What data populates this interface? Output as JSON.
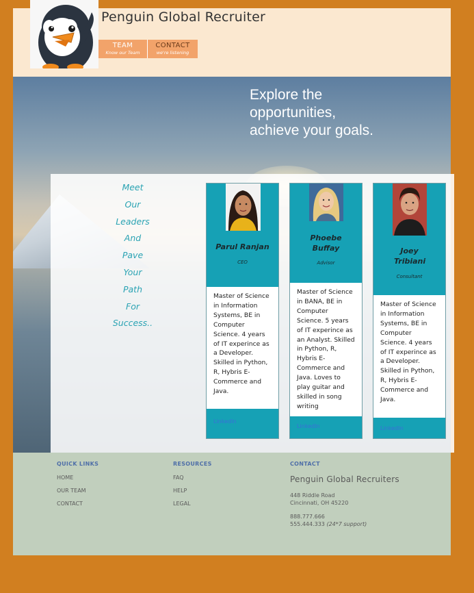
{
  "header": {
    "site_title": "Penguin Global Recruiter",
    "logo_icon": "penguin-mascot-icon",
    "nav": [
      {
        "title": "TEAM",
        "subtitle": "Know our Team"
      },
      {
        "title": "CONTACT",
        "subtitle": "we're listening"
      }
    ]
  },
  "hero": {
    "tagline": "Explore the\nopportunities,\nachieve your goals."
  },
  "leaders": {
    "heading_words": [
      "Meet",
      "Our",
      "Leaders",
      "And",
      "Pave",
      "Your",
      "Path",
      "For",
      "Success.."
    ]
  },
  "team": [
    {
      "name": "Parul Ranjan",
      "role": "CEO",
      "bio": "Master of Science in Information Systems, BE in Computer Science. 4 years of IT experince as a Developer. Skilled in Python, R, Hybris E-Commerce and Java.",
      "link": "LinkedIn"
    },
    {
      "name": "Phoebe Buffay",
      "role": "Advisor",
      "bio": "Master of Science in BANA, BE in Computer Science. 5 years of IT experince as an Analyst. Skilled in Python, R, Hybris E-Commerce and Java. Loves to play guitar and skilled in song writing",
      "link": "LinkedIn"
    },
    {
      "name": "Joey Tribiani",
      "role": "Consultant",
      "bio": "Master of Science in Information Systems, BE in Computer Science. 4 years of IT experince as a Developer. Skilled in Python, R, Hybris E-Commerce and Java.",
      "link": "LinkedIn"
    }
  ],
  "footer": {
    "quick_links": {
      "heading": "QUICK LINKS",
      "items": [
        "HOME",
        "OUR TEAM",
        "CONTACT"
      ]
    },
    "resources": {
      "heading": "RESOURCES",
      "items": [
        "FAQ",
        "HELP",
        "LEGAL"
      ]
    },
    "contact": {
      "heading": "CONTACT",
      "company": "Penguin Global Recruiters",
      "address1": "448 Riddle Road",
      "address2": "Cincinnati, OH 45220",
      "phone1": "888.777.666",
      "phone2": "555.444.333",
      "phone2_note": "(24*7 support)"
    }
  },
  "colors": {
    "page_bg": "#d17f20",
    "header_bg": "#fbe8d0",
    "nav_bg": "#f2a36a",
    "card_bg": "#16a1b5",
    "accent_text": "#2aa3b3",
    "footer_bg": "#c1cfbd",
    "link": "#3a6fd8"
  }
}
